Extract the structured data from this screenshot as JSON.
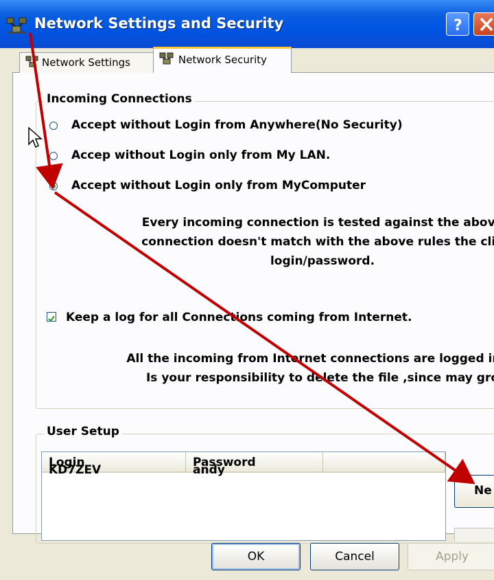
{
  "window": {
    "title": "Network Settings and Security",
    "help_label": "?"
  },
  "tabs": [
    {
      "label": "Network Settings",
      "active": false
    },
    {
      "label": "Network Security",
      "active": true
    }
  ],
  "incoming": {
    "legend": "Incoming Connections",
    "options": [
      {
        "label": "Accept without Login  from Anywhere(No Security)",
        "selected": false
      },
      {
        "label": "Accep without Login only from My LAN.",
        "selected": false
      },
      {
        "label": "Accept without Login only from MyComputer",
        "selected": true
      }
    ],
    "info_lines": [
      "Every incoming connection is tested against the above",
      "connection doesn't match with the above rules the clie",
      "login/password."
    ],
    "log_checkbox": {
      "label": "Keep a log for all Connections coming from Internet.",
      "checked": true
    },
    "log_lines": [
      "All the incoming from Internet connections are logged in th",
      "Is your responsibility to delete the file ,since may gro"
    ]
  },
  "user_setup": {
    "legend": "User Setup",
    "columns": [
      "Login",
      "Password",
      ""
    ],
    "rows": [
      {
        "login": "KD7ZEV",
        "password": "andy"
      }
    ],
    "new_button_label": "Ne"
  },
  "buttons": {
    "ok": "OK",
    "cancel": "Cancel",
    "apply": "Apply"
  },
  "colors": {
    "titlebar": "#0054e3",
    "annotation_arrow": "#c00000",
    "tab_highlight": "#ffc83c"
  }
}
